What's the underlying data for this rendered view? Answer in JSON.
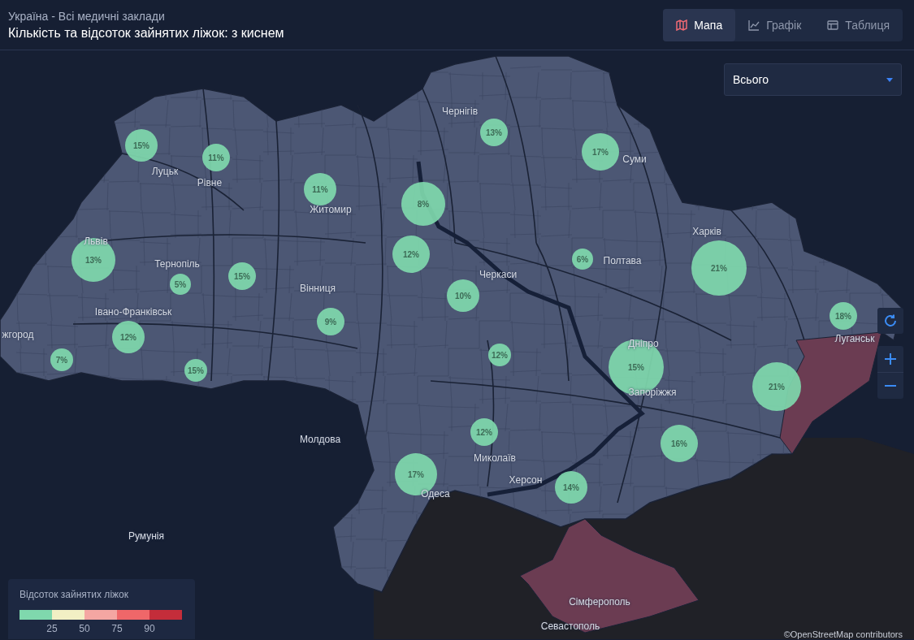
{
  "header": {
    "subtitle": "Україна - Всі медичні заклади",
    "title": "Кількість та відсоток зайнятих ліжок: з киснем"
  },
  "view_tabs": [
    {
      "label": "Мапа",
      "selected": true,
      "kind": "map"
    },
    {
      "label": "Графік",
      "selected": false,
      "kind": "chart"
    },
    {
      "label": "Таблиця",
      "selected": false,
      "kind": "table"
    }
  ],
  "filter": {
    "value": "Всього"
  },
  "map": {
    "cities": [
      {
        "name": "Чернігів"
      },
      {
        "name": "Суми"
      },
      {
        "name": "Луцьк"
      },
      {
        "name": "Рівне"
      },
      {
        "name": "Житомир"
      },
      {
        "name": "Харків"
      },
      {
        "name": "Львів"
      },
      {
        "name": "Тернопіль"
      },
      {
        "name": "Полтава"
      },
      {
        "name": "Черкаси"
      },
      {
        "name": "Вінниця"
      },
      {
        "name": "Івано-Франківськ"
      },
      {
        "name": "Луганськ"
      },
      {
        "name": "жгород"
      },
      {
        "name": "Дніпро"
      },
      {
        "name": "Запоріжжя"
      },
      {
        "name": "Молдова"
      },
      {
        "name": "Миколаїв"
      },
      {
        "name": "Херсон"
      },
      {
        "name": "Одеса"
      },
      {
        "name": "Румунія"
      },
      {
        "name": "Сімферополь"
      },
      {
        "name": "Севастополь"
      }
    ],
    "markers": [
      {
        "label": "15%"
      },
      {
        "label": "11%"
      },
      {
        "label": "11%"
      },
      {
        "label": "8%"
      },
      {
        "label": "13%"
      },
      {
        "label": "17%"
      },
      {
        "label": "13%"
      },
      {
        "label": "5%"
      },
      {
        "label": "15%"
      },
      {
        "label": "12%"
      },
      {
        "label": "10%"
      },
      {
        "label": "6%"
      },
      {
        "label": "21%"
      },
      {
        "label": "18%"
      },
      {
        "label": "9%"
      },
      {
        "label": "12%"
      },
      {
        "label": "7%"
      },
      {
        "label": "15%"
      },
      {
        "label": "12%"
      },
      {
        "label": "15%"
      },
      {
        "label": "21%"
      },
      {
        "label": "12%"
      },
      {
        "label": "16%"
      },
      {
        "label": "17%"
      },
      {
        "label": "14%"
      }
    ],
    "attribution": "©OpenStreetMap contributors"
  },
  "legend": {
    "title": "Відсоток зайнятих ліжок",
    "bins": [
      {
        "color": "#7fd8ad"
      },
      {
        "color": "#f2efc4"
      },
      {
        "color": "#f4a6a2"
      },
      {
        "color": "#ef6769"
      },
      {
        "color": "#c42d3a"
      }
    ],
    "ticks": [
      "25",
      "50",
      "75",
      "90"
    ]
  }
}
